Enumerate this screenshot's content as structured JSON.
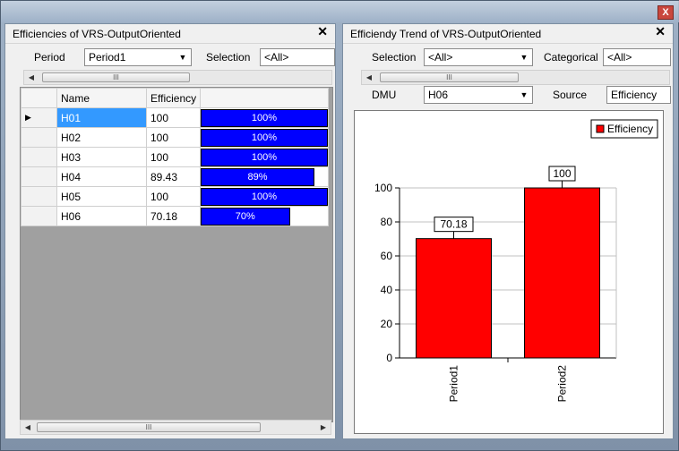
{
  "left_pane": {
    "title": "Efficiencies of VRS-OutputOriented",
    "period_label": "Period",
    "period_value": "Period1",
    "selection_label": "Selection",
    "selection_value": "<All>",
    "columns": [
      "Name",
      "Efficiency",
      ""
    ],
    "rows": [
      {
        "name": "H01",
        "eff": "100",
        "pct": "100%",
        "fraction": 1.0
      },
      {
        "name": "H02",
        "eff": "100",
        "pct": "100%",
        "fraction": 1.0
      },
      {
        "name": "H03",
        "eff": "100",
        "pct": "100%",
        "fraction": 1.0
      },
      {
        "name": "H04",
        "eff": "89.43",
        "pct": "89%",
        "fraction": 0.8943
      },
      {
        "name": "H05",
        "eff": "100",
        "pct": "100%",
        "fraction": 1.0
      },
      {
        "name": "H06",
        "eff": "70.18",
        "pct": "70%",
        "fraction": 0.7018
      }
    ],
    "scroll_thumb": "III"
  },
  "right_pane": {
    "title": "Efficiendy Trend of VRS-OutputOriented",
    "selection_label": "Selection",
    "selection_value": "<All>",
    "categorical_label": "Categorical",
    "categorical_value": "<All>",
    "dmu_label": "DMU",
    "dmu_value": "H06",
    "source_label": "Source",
    "source_value": "Efficiency",
    "scroll_thumb": "III"
  },
  "chart_data": {
    "type": "bar",
    "categories": [
      "Period1",
      "Period2"
    ],
    "series": [
      {
        "name": "Efficiency",
        "values": [
          70.18,
          100
        ],
        "color": "#ff0000"
      }
    ],
    "data_labels": [
      "70.18",
      "100"
    ],
    "ylim": [
      0,
      100
    ],
    "yticks": [
      0,
      20,
      40,
      60,
      80,
      100
    ],
    "grid": true,
    "legend": "top-right"
  },
  "close_glyph": "X",
  "pane_close_glyph": "✕"
}
